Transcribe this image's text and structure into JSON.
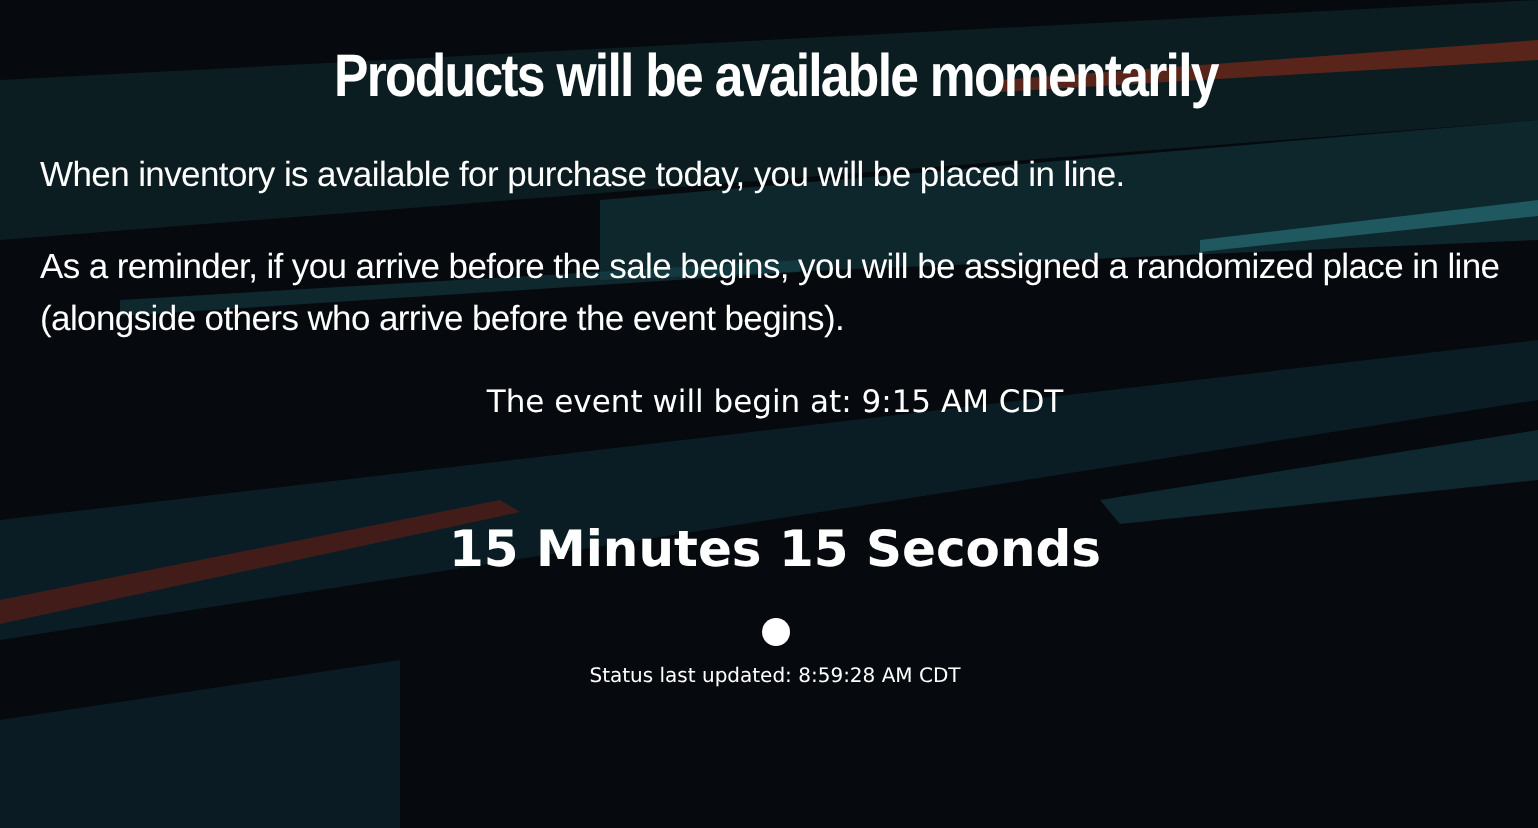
{
  "title": "Products will be available momentarily",
  "paragraphs": [
    "When inventory is available for purchase today, you will be placed in line.",
    "As a reminder, if you arrive before the sale begins, you will be assigned a randomized place in line (alongside others who arrive before the event begins)."
  ],
  "event_start": "The event will begin at: 9:15 AM CDT",
  "countdown": "15 Minutes 15 Seconds",
  "status": "Status last updated: 8:59:28 AM CDT"
}
